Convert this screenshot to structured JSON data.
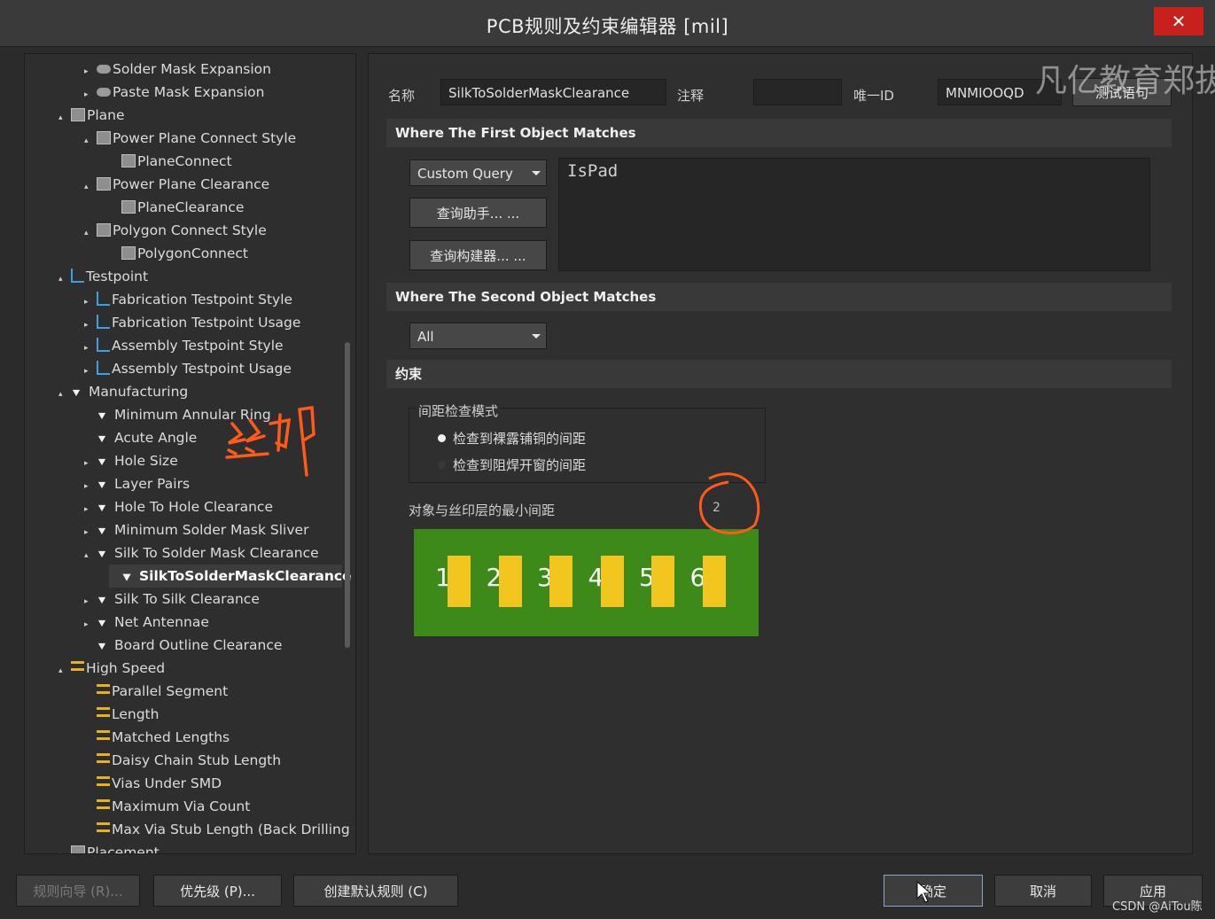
{
  "window": {
    "title": "PCB规则及约束编辑器 [mil]",
    "close_glyph": "✕"
  },
  "tree": {
    "items": [
      {
        "label": "Solder Mask Expansion",
        "arrow": "▸",
        "icon": "pill-icon"
      },
      {
        "label": "Paste Mask Expansion",
        "arrow": "▸",
        "icon": "pill-icon"
      },
      {
        "label": "Plane",
        "arrow": "▴",
        "icon": "plane-icon"
      },
      {
        "label": "Power Plane Connect Style",
        "arrow": "▴",
        "icon": "plane-icon"
      },
      {
        "label": "PlaneConnect",
        "arrow": "",
        "icon": "plane-icon"
      },
      {
        "label": "Power Plane Clearance",
        "arrow": "▴",
        "icon": "plane-icon"
      },
      {
        "label": "PlaneClearance",
        "arrow": "",
        "icon": "plane-icon"
      },
      {
        "label": "Polygon Connect Style",
        "arrow": "▴",
        "icon": "plane-icon"
      },
      {
        "label": "PolygonConnect",
        "arrow": "",
        "icon": "plane-icon"
      },
      {
        "label": "Testpoint",
        "arrow": "▴",
        "icon": "testpoint-icon"
      },
      {
        "label": "Fabrication Testpoint Style",
        "arrow": "▸",
        "icon": "testpoint-icon"
      },
      {
        "label": "Fabrication Testpoint Usage",
        "arrow": "▸",
        "icon": "testpoint-icon"
      },
      {
        "label": "Assembly Testpoint Style",
        "arrow": "▸",
        "icon": "testpoint-icon"
      },
      {
        "label": "Assembly Testpoint Usage",
        "arrow": "▸",
        "icon": "testpoint-icon"
      },
      {
        "label": "Manufacturing",
        "arrow": "▴",
        "icon": "manufacturing-icon"
      },
      {
        "label": "Minimum Annular Ring",
        "arrow": "",
        "icon": "manufacturing-icon"
      },
      {
        "label": "Acute Angle",
        "arrow": "",
        "icon": "manufacturing-icon"
      },
      {
        "label": "Hole Size",
        "arrow": "▸",
        "icon": "manufacturing-icon"
      },
      {
        "label": "Layer Pairs",
        "arrow": "▸",
        "icon": "manufacturing-icon"
      },
      {
        "label": "Hole To Hole Clearance",
        "arrow": "▸",
        "icon": "manufacturing-icon"
      },
      {
        "label": "Minimum Solder Mask Sliver",
        "arrow": "▸",
        "icon": "manufacturing-icon"
      },
      {
        "label": "Silk To Solder Mask Clearance",
        "arrow": "▴",
        "icon": "manufacturing-icon"
      },
      {
        "label": "SilkToSolderMaskClearance",
        "arrow": "",
        "icon": "manufacturing-icon"
      },
      {
        "label": "Silk To Silk Clearance",
        "arrow": "▸",
        "icon": "manufacturing-icon"
      },
      {
        "label": "Net Antennae",
        "arrow": "▸",
        "icon": "manufacturing-icon"
      },
      {
        "label": "Board Outline Clearance",
        "arrow": "",
        "icon": "manufacturing-icon"
      },
      {
        "label": "High Speed",
        "arrow": "▴",
        "icon": "highspeed-icon"
      },
      {
        "label": "Parallel Segment",
        "arrow": "",
        "icon": "highspeed-icon"
      },
      {
        "label": "Length",
        "arrow": "",
        "icon": "highspeed-icon"
      },
      {
        "label": "Matched Lengths",
        "arrow": "",
        "icon": "highspeed-icon"
      },
      {
        "label": "Daisy Chain Stub Length",
        "arrow": "",
        "icon": "highspeed-icon"
      },
      {
        "label": "Vias Under SMD",
        "arrow": "",
        "icon": "highspeed-icon"
      },
      {
        "label": "Maximum Via Count",
        "arrow": "",
        "icon": "highspeed-icon"
      },
      {
        "label": "Max Via Stub Length (Back Drilling",
        "arrow": "",
        "icon": "highspeed-icon"
      },
      {
        "label": "Placement",
        "arrow": "▴",
        "icon": "plane-icon"
      }
    ],
    "selected": "SilkToSolderMaskClearance"
  },
  "rule": {
    "name_label": "名称",
    "name_value": "SilkToSolderMaskClearance",
    "comment_label": "注释",
    "comment_value": "",
    "uid_label": "唯一ID",
    "uid_value": "MNMIOOQD",
    "test_button": "测试语句"
  },
  "first_match": {
    "header": "Where The First Object Matches",
    "select_value": "Custom Query",
    "query_helper_button": "查询助手... ...",
    "query_builder_button": "查询构建器... ...",
    "query_text": "IsPad"
  },
  "second_match": {
    "header": "Where The Second Object Matches",
    "select_value": "All"
  },
  "constraints": {
    "header": "约束",
    "group_label": "间距检查模式",
    "radio_1": "检查到裸露铺铜的间距",
    "radio_2": "检查到阻焊开窗的间距",
    "radio_selected": 1,
    "min_clearance_label": "对象与丝印层的最小间距",
    "min_clearance_value": "2",
    "pads": [
      "1",
      "2",
      "3",
      "4",
      "5",
      "6"
    ]
  },
  "annotations": {
    "handwritten_text": "丝印"
  },
  "bottom": {
    "rule_wizard": "规则向导 (R)...",
    "priorities": "优先级 (P)...",
    "create_default": "创建默认规则 (C)",
    "ok": "确定",
    "cancel": "取消",
    "apply": "应用"
  },
  "watermark": "凡亿教育郑拔",
  "credit": "CSDN @AiTou陈",
  "colors": {
    "pcb_green": "#3d8a1a",
    "pad_yellow": "#f3c51f",
    "annotation_orange": "#ff5a1a",
    "close_red": "#c8201d"
  }
}
